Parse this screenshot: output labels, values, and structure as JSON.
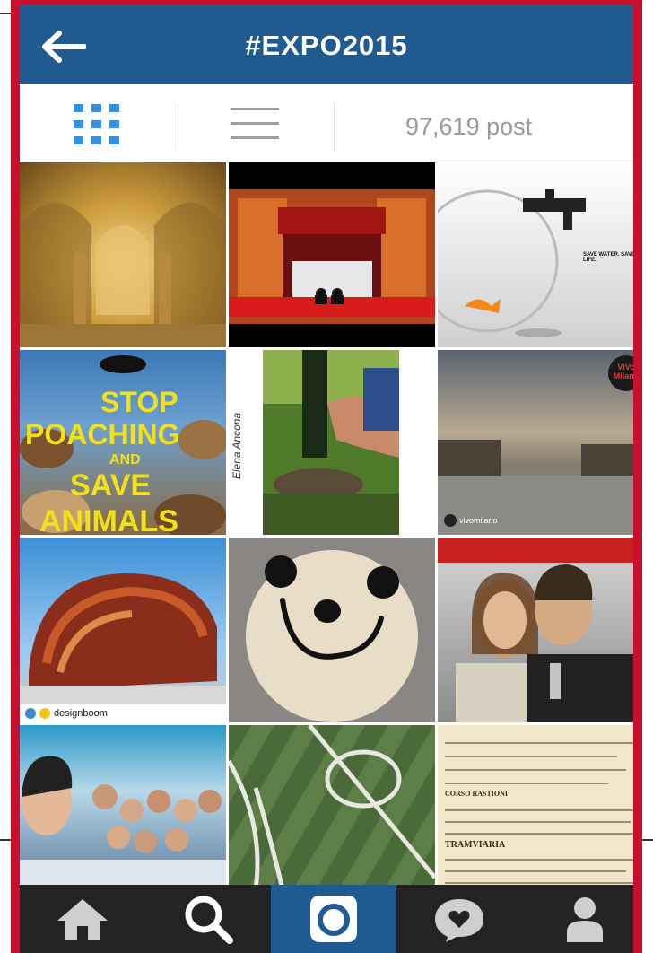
{
  "header": {
    "title": "#EXPO2015"
  },
  "toolbar": {
    "post_count": "97,619 post"
  },
  "tiles": [
    {
      "name": "cloister-crypt-photo"
    },
    {
      "name": "theater-stage-photo"
    },
    {
      "name": "fishbowl-tap-photo",
      "caption": "SAVE WATER. SAVE LIFE."
    },
    {
      "name": "stop-poaching-poster",
      "lines": [
        "STOP",
        "POACHING",
        "AND",
        "SAVE",
        "ANIMALS"
      ]
    },
    {
      "name": "wine-bottle-photo",
      "signature": "Elena Ancona"
    },
    {
      "name": "milan-square-photo",
      "badge": "ViVo Milano",
      "credit": "vivomilano"
    },
    {
      "name": "pavilion-photo",
      "credit": "designboom"
    },
    {
      "name": "bear-rug-photo"
    },
    {
      "name": "couple-selfie-photo"
    },
    {
      "name": "group-selfie-photo"
    },
    {
      "name": "football-field-rug-photo"
    },
    {
      "name": "document-page-photo",
      "heading": "CORSO RASTIONI",
      "subheading": "TRAMVIARIA"
    }
  ],
  "colors": {
    "header": "#1f5b8f",
    "border": "#c8102e",
    "grid_icon": "#3b8ed8",
    "tabbar": "#232323"
  },
  "tabs": [
    {
      "name": "home-icon"
    },
    {
      "name": "search-icon"
    },
    {
      "name": "camera-icon",
      "active": true
    },
    {
      "name": "activity-icon"
    },
    {
      "name": "profile-icon"
    }
  ]
}
